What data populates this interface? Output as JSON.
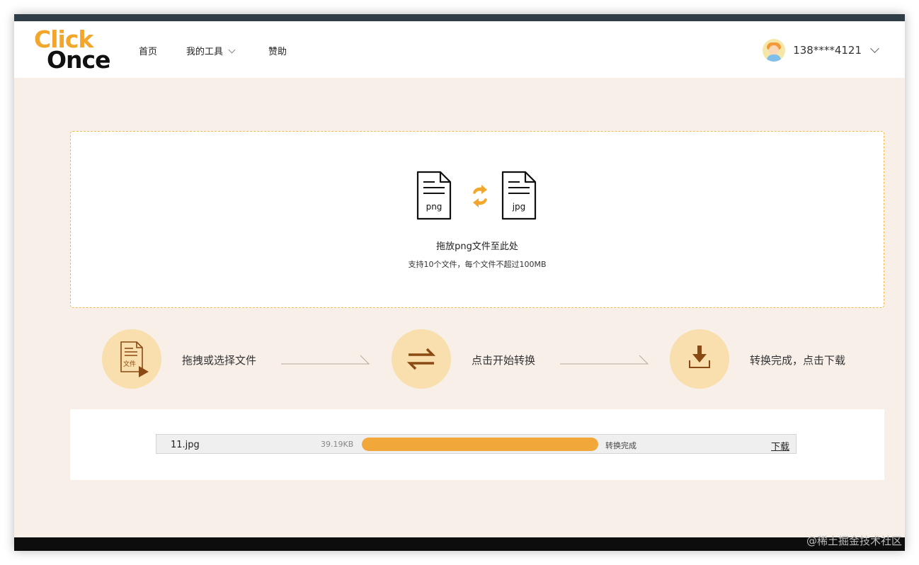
{
  "brand": {
    "logo_line1": "Click",
    "logo_line2": "Once",
    "accent_color": "#f2a62c"
  },
  "nav": {
    "home": "首页",
    "tools": "我的工具",
    "sponsor": "赞助"
  },
  "user": {
    "name": "138****4121"
  },
  "dropzone": {
    "source_format": "png",
    "target_format": "jpg",
    "title": "拖放png文件至此处",
    "subtitle": "支持10个文件，每个文件不超过100MB"
  },
  "steps": [
    {
      "label": "拖拽或选择文件",
      "icon": "file-select-icon",
      "icon_text": "文件"
    },
    {
      "label": "点击开始转换",
      "icon": "convert-arrows-icon"
    },
    {
      "label": "转换完成，点击下载",
      "icon": "download-icon"
    }
  ],
  "files": [
    {
      "name": "11.jpg",
      "size": "39.19KB",
      "progress": 1.0,
      "status": "转换完成",
      "action": "下载"
    }
  ],
  "watermark": "@稀土掘金技术社区"
}
